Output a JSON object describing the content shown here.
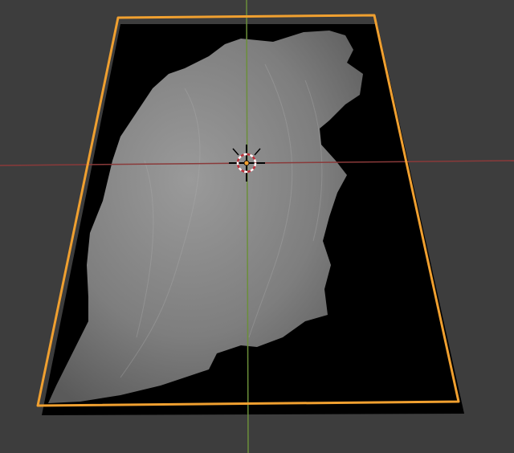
{
  "viewport": {
    "background_color": "#3d3d3d",
    "x_axis_color": "#8a3a3a",
    "y_axis_color": "#6b8f3a",
    "selection_outline_color": "#f0a030",
    "plane_color": "#000000",
    "terrain_color": "#8a8a8a",
    "cursor_ring_color": "#c0303a",
    "origin_color": "#f0a030"
  }
}
